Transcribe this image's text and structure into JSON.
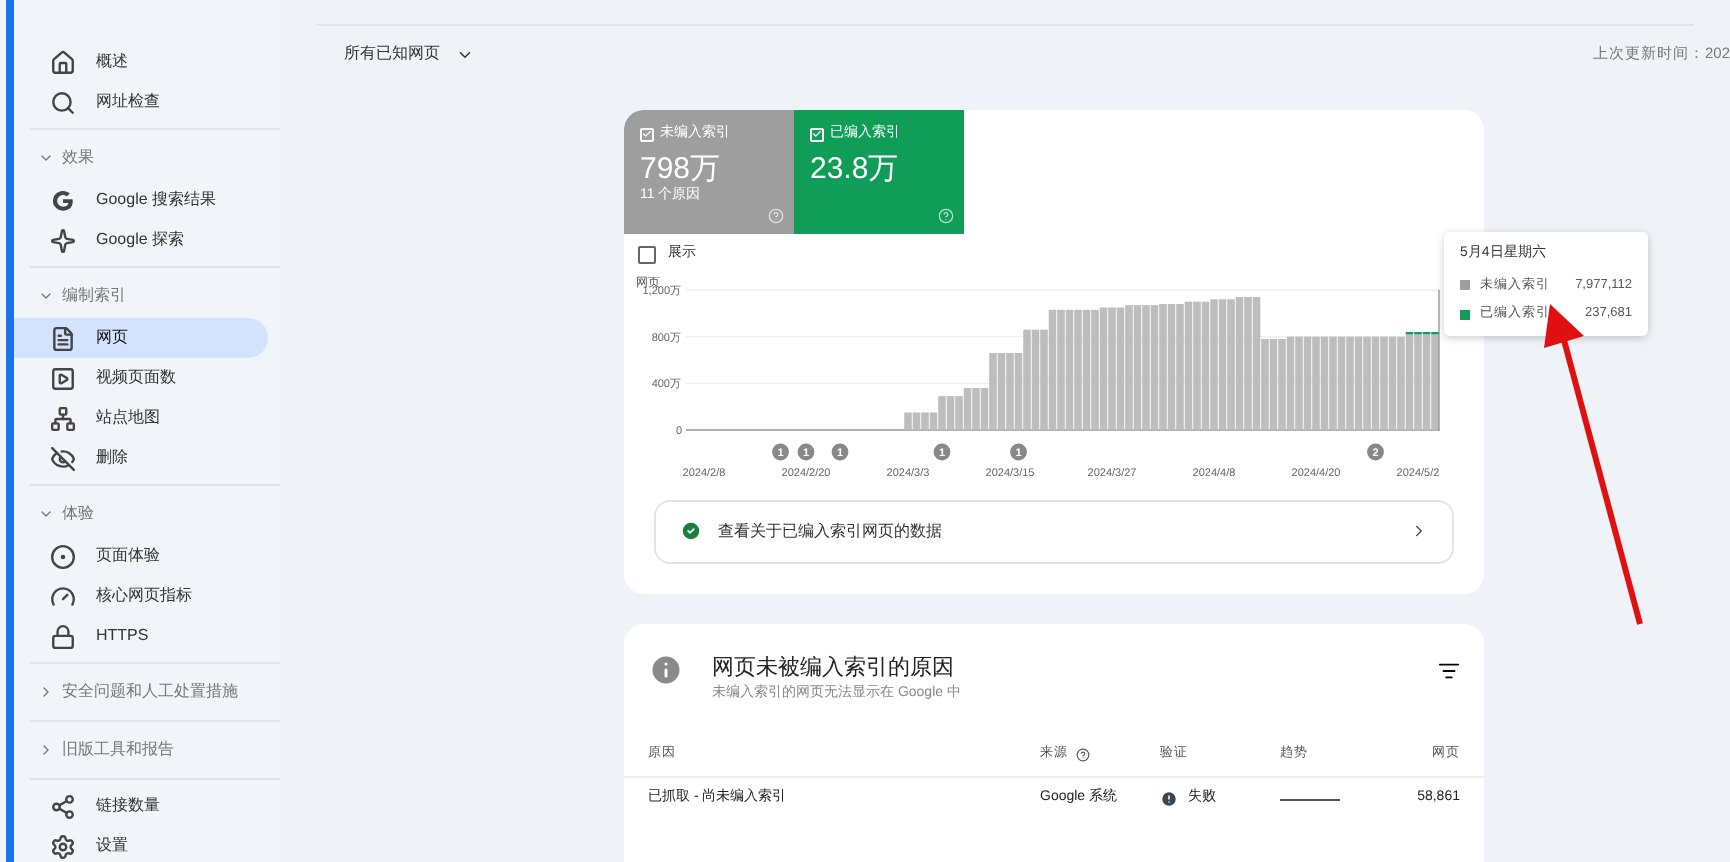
{
  "sidebar": {
    "sections": [
      {
        "kind": "plain",
        "items": [
          {
            "label": "概述",
            "selected": false
          },
          {
            "label": "网址检查",
            "selected": false
          }
        ]
      },
      {
        "kind": "group",
        "title": "效果",
        "expanded": true,
        "items": [
          {
            "label": "Google 搜索结果",
            "selected": false
          },
          {
            "label": "Google 探索",
            "selected": false
          }
        ]
      },
      {
        "kind": "group",
        "title": "编制索引",
        "expanded": true,
        "items": [
          {
            "label": "网页",
            "selected": true
          },
          {
            "label": "视频页面数",
            "selected": false
          },
          {
            "label": "站点地图",
            "selected": false
          },
          {
            "label": "删除",
            "selected": false
          }
        ]
      },
      {
        "kind": "group",
        "title": "体验",
        "expanded": true,
        "items": [
          {
            "label": "页面体验",
            "selected": false
          },
          {
            "label": "核心网页指标",
            "selected": false
          },
          {
            "label": "HTTPS",
            "selected": false
          }
        ]
      },
      {
        "kind": "group",
        "title": "安全问题和人工处置措施",
        "expanded": false
      },
      {
        "kind": "group",
        "title": "旧版工具和报告",
        "expanded": false
      },
      {
        "kind": "plain",
        "items": [
          {
            "label": "链接数量",
            "selected": false
          },
          {
            "label": "设置",
            "selected": false
          }
        ]
      }
    ]
  },
  "filter": {
    "label": "所有已知网页"
  },
  "last_updated": "上次更新时间：202",
  "summary_tiles": [
    {
      "label": "未编入索引",
      "value": "798万",
      "note": "11 个原因",
      "checked": true,
      "color": "#9e9e9e"
    },
    {
      "label": "已编入索引",
      "value": "23.8万",
      "checked": true,
      "color": "#0f9d58"
    }
  ],
  "impressions": {
    "label": "展示",
    "checked": false
  },
  "chart_data": {
    "type": "bar",
    "stacked": true,
    "ylabel": "网页",
    "ylim": [
      0,
      1200
    ],
    "yticks": [
      {
        "value": 0,
        "label": "0"
      },
      {
        "value": 400,
        "label": "400万"
      },
      {
        "value": 800,
        "label": "800万"
      },
      {
        "value": 1200,
        "label": "1,200万"
      }
    ],
    "categories": [
      "2024/2/8",
      null,
      null,
      null,
      null,
      null,
      null,
      null,
      null,
      null,
      null,
      null,
      "2024/2/20",
      null,
      null,
      null,
      null,
      null,
      null,
      null,
      null,
      null,
      null,
      null,
      "2024/3/3",
      null,
      null,
      null,
      null,
      null,
      null,
      null,
      null,
      null,
      null,
      null,
      "2024/3/15",
      null,
      null,
      null,
      null,
      null,
      null,
      null,
      null,
      null,
      null,
      null,
      "2024/3/27",
      null,
      null,
      null,
      null,
      null,
      null,
      null,
      null,
      null,
      null,
      null,
      "2024/4/8",
      null,
      null,
      null,
      null,
      null,
      null,
      null,
      null,
      null,
      null,
      null,
      "2024/4/20",
      null,
      null,
      null,
      null,
      null,
      null,
      null,
      null,
      null,
      null,
      null,
      "2024/5/2",
      null,
      null
    ],
    "series": [
      {
        "color": "#bdbdbd",
        "values": [
          0,
          0,
          0,
          0,
          0,
          0,
          0,
          0,
          0,
          0,
          0,
          0,
          0,
          0,
          0,
          0,
          0,
          0,
          0,
          0,
          0,
          0,
          0,
          0,
          150,
          150,
          150,
          150,
          290,
          290,
          290,
          360,
          360,
          360,
          660,
          660,
          660,
          660,
          860,
          860,
          860,
          1030,
          1030,
          1030,
          1030,
          1030,
          1030,
          1050,
          1050,
          1050,
          1070,
          1070,
          1070,
          1070,
          1080,
          1080,
          1080,
          1100,
          1100,
          1100,
          1120,
          1120,
          1120,
          1140,
          1140,
          1140,
          780,
          780,
          780,
          800,
          800,
          800,
          800,
          800,
          800,
          800,
          800,
          800,
          800,
          800,
          800,
          800,
          800,
          820,
          820,
          820,
          820
        ]
      },
      {
        "color": "#0f9d58",
        "values": [
          null,
          null,
          null,
          null,
          null,
          null,
          null,
          null,
          null,
          null,
          null,
          null,
          null,
          null,
          null,
          null,
          null,
          null,
          null,
          null,
          null,
          null,
          null,
          null,
          null,
          null,
          null,
          null,
          null,
          null,
          null,
          null,
          null,
          null,
          null,
          null,
          null,
          null,
          null,
          null,
          null,
          null,
          null,
          null,
          null,
          null,
          null,
          null,
          null,
          null,
          null,
          null,
          null,
          null,
          null,
          null,
          null,
          null,
          null,
          null,
          null,
          null,
          null,
          null,
          null,
          null,
          null,
          null,
          null,
          null,
          null,
          null,
          null,
          null,
          null,
          null,
          null,
          null,
          null,
          null,
          null,
          null,
          null,
          20,
          20,
          20,
          20
        ]
      }
    ],
    "annotations": [
      "1",
      "1",
      "1",
      "1",
      "1",
      "2"
    ]
  },
  "tooltip": {
    "title": "5月4日星期六",
    "rows": [
      {
        "label": "未编入索引",
        "value": "7,977,112",
        "color": "#9e9e9e"
      },
      {
        "label": "已编入索引",
        "value": "237,681",
        "color": "#0f9d58"
      }
    ]
  },
  "indexed_link": {
    "label": "查看关于已编入索引网页的数据"
  },
  "reasons": {
    "title": "网页未被编入索引的原因",
    "subtitle": "未编入索引的网页无法显示在 Google 中",
    "columns": [
      "原因",
      "来源",
      "验证",
      "趋势",
      "网页"
    ],
    "rows": [
      {
        "reason": "已抓取 - 尚未编入索引",
        "source": "Google 系统",
        "validation": "失败",
        "pages": "58,861"
      }
    ]
  }
}
